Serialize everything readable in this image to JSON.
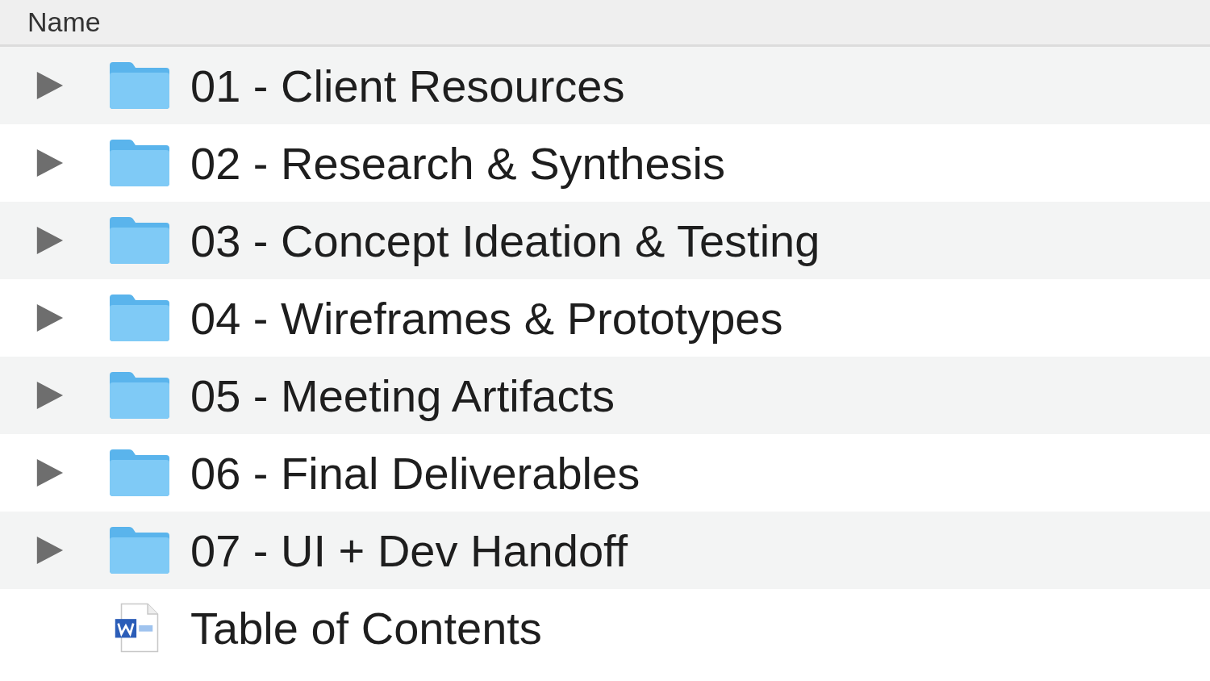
{
  "header": {
    "column": "Name"
  },
  "rows": [
    {
      "kind": "folder",
      "name": "01 - Client Resources",
      "expanded": false
    },
    {
      "kind": "folder",
      "name": "02 - Research & Synthesis",
      "expanded": false
    },
    {
      "kind": "folder",
      "name": "03 - Concept Ideation & Testing",
      "expanded": false
    },
    {
      "kind": "folder",
      "name": "04 - Wireframes & Prototypes",
      "expanded": false
    },
    {
      "kind": "folder",
      "name": "05 - Meeting Artifacts",
      "expanded": false
    },
    {
      "kind": "folder",
      "name": "06 - Final Deliverables",
      "expanded": false
    },
    {
      "kind": "folder",
      "name": "07 - UI + Dev Handoff",
      "expanded": false
    },
    {
      "kind": "document",
      "name": "Table of Contents"
    }
  ]
}
